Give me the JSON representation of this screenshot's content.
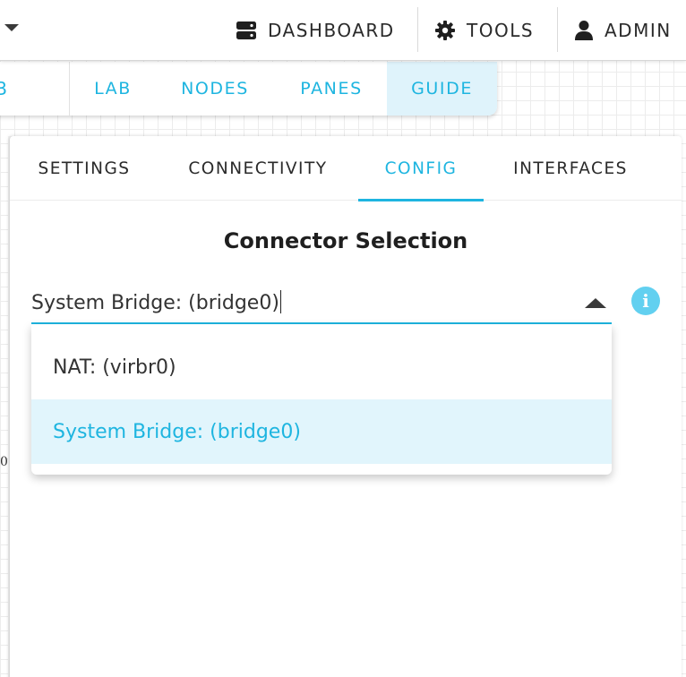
{
  "topbar": {
    "dashboard_label": "DASHBOARD",
    "tools_label": "TOOLS",
    "admin_label": "ADMIN",
    "icons": [
      "server-icon",
      "gear-icon",
      "user-icon",
      "chevron-down-icon"
    ]
  },
  "subnav": {
    "cut_item": "B",
    "items": [
      "LAB",
      "NODES",
      "PANES",
      "GUIDE"
    ],
    "active": "GUIDE"
  },
  "panel": {
    "tabs": [
      "SETTINGS",
      "CONNECTIVITY",
      "CONFIG",
      "INTERFACES"
    ],
    "active_tab": "CONFIG",
    "section_title": "Connector Selection",
    "select": {
      "value": "System Bridge: (bridge0)",
      "options": [
        "NAT: (virbr0)",
        "System Bridge: (bridge0)"
      ],
      "selected_option": "System Bridge: (bridge0)"
    },
    "info_glyph": "i"
  },
  "background_fragment": "0",
  "colors": {
    "accent": "#1eb5e0",
    "selected_bg": "#e1f5fc",
    "info_icon": "#62d0f0"
  }
}
